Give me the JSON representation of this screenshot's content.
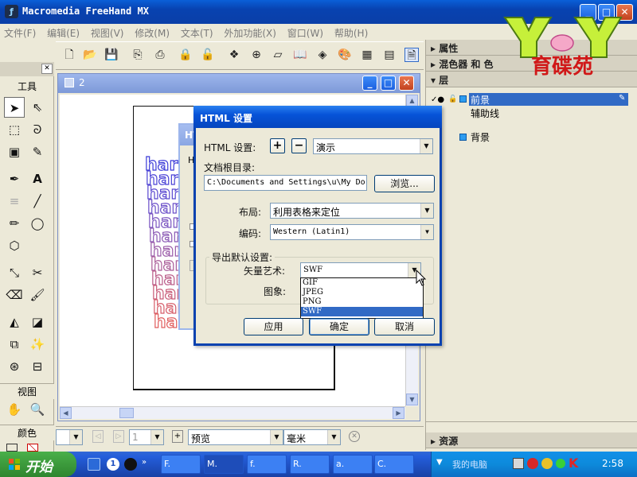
{
  "app": {
    "title": "Macromedia FreeHand MX",
    "logo_glyph": "ƒ"
  },
  "menu": [
    "文件(F)",
    "编辑(E)",
    "视图(V)",
    "修改(M)",
    "文本(T)",
    "外加功能(X)",
    "窗口(W)",
    "帮助(H)"
  ],
  "toolbar_icons": [
    "new-document-icon",
    "open-icon",
    "save-icon",
    "import-icon",
    "export-icon",
    "lock-icon",
    "unlock-icon",
    "align-icon",
    "transform-icon",
    "distribute-icon",
    "library-icon",
    "symbol-icon",
    "swatch-icon",
    "table-icon",
    "layers-icon",
    "html-output-icon"
  ],
  "tools": {
    "header": "工具",
    "view_label": "视图",
    "color_label": "颜色"
  },
  "doc": {
    "title": "2"
  },
  "bg_dialog": {
    "title": "HT",
    "fragment": "H"
  },
  "dialog": {
    "title": "HTML 设置",
    "html_settings_label": "HTML 设置:",
    "html_settings_value": "演示",
    "docroot_label": "文档根目录:",
    "docroot_value": "C:\\Documents and Settings\\u\\My Do",
    "browse_button": "浏览...",
    "layout_label": "布局:",
    "layout_value": "利用表格来定位",
    "encoding_label": "编码:",
    "encoding_value": "Western (Latin1)",
    "export_group_label": "导出默认设置:",
    "vector_label": "矢量艺术:",
    "vector_value": "SWF",
    "image_label": "图象:",
    "format_options": [
      "GIF",
      "JPEG",
      "PNG",
      "SWF"
    ],
    "selected_option": "SWF",
    "apply_button": "应用",
    "ok_button": "确定",
    "cancel_button": "取消",
    "plus": "+",
    "minus": "−"
  },
  "status": {
    "page_value": "1",
    "preview_value": "预览",
    "unit_value": "毫米"
  },
  "panels": {
    "properties": "属性",
    "mixer": "混色器 和 色",
    "layers": "层",
    "layer_rows": [
      "前景",
      "辅助线",
      "背景"
    ],
    "assets": "资源"
  },
  "watermark": {
    "text": "育碟苑"
  },
  "taskbar": {
    "start": "开始",
    "tasks": [
      "F.",
      "M.",
      "f.",
      "R.",
      "a.",
      "C."
    ],
    "tray_label": "我的电脑",
    "clock": "2:58",
    "k_label": "K"
  },
  "colors": {
    "xp_blue": "#0842b0",
    "selection": "#316ac5",
    "panel": "#ece9d8"
  }
}
